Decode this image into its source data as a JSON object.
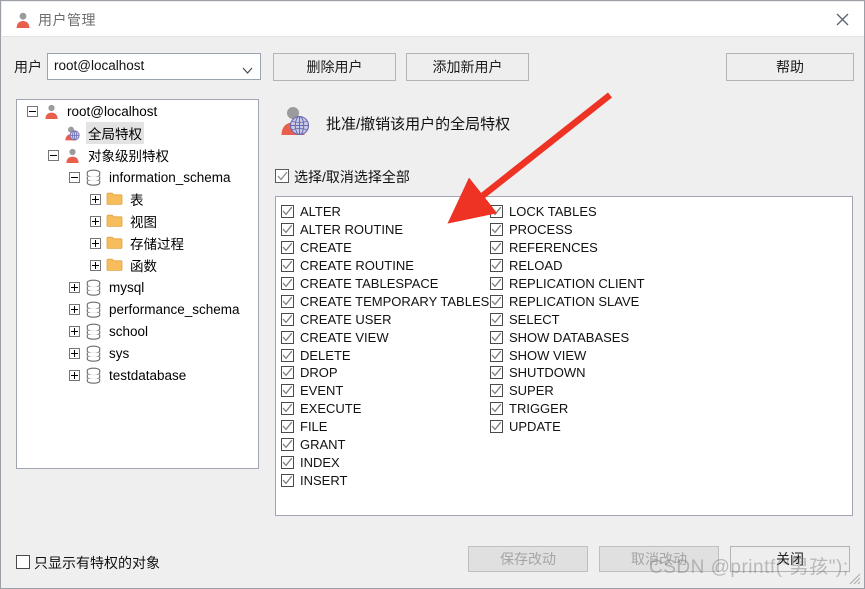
{
  "window": {
    "title": "用户管理",
    "title_icon": "user-icon",
    "close_icon": "close-icon"
  },
  "toolbar": {
    "user_label": "用户",
    "user_combo_value": "root@localhost",
    "user_combo_icon": "chevron-down-icon",
    "delete_user_label": "删除用户",
    "add_user_label": "添加新用户",
    "help_label": "帮助"
  },
  "tree": {
    "nodes": [
      {
        "label": "root@localhost",
        "indent": 0,
        "toggle": "minus",
        "icon": "user-icon",
        "selected": false
      },
      {
        "label": "全局特权",
        "indent": 1,
        "toggle": "none",
        "icon": "globe-user-icon",
        "selected": true
      },
      {
        "label": "对象级别特权",
        "indent": 1,
        "toggle": "minus",
        "icon": "user-icon",
        "selected": false
      },
      {
        "label": "information_schema",
        "indent": 2,
        "toggle": "minus",
        "icon": "database-icon",
        "selected": false
      },
      {
        "label": "表",
        "indent": 3,
        "toggle": "plus",
        "icon": "folder-icon",
        "selected": false
      },
      {
        "label": "视图",
        "indent": 3,
        "toggle": "plus",
        "icon": "folder-icon",
        "selected": false
      },
      {
        "label": "存储过程",
        "indent": 3,
        "toggle": "plus",
        "icon": "folder-icon",
        "selected": false
      },
      {
        "label": "函数",
        "indent": 3,
        "toggle": "plus",
        "icon": "folder-icon",
        "selected": false
      },
      {
        "label": "mysql",
        "indent": 2,
        "toggle": "plus",
        "icon": "database-icon",
        "selected": false
      },
      {
        "label": "performance_schema",
        "indent": 2,
        "toggle": "plus",
        "icon": "database-icon",
        "selected": false
      },
      {
        "label": "school",
        "indent": 2,
        "toggle": "plus",
        "icon": "database-icon",
        "selected": false
      },
      {
        "label": "sys",
        "indent": 2,
        "toggle": "plus",
        "icon": "database-icon",
        "selected": false
      },
      {
        "label": "testdatabase",
        "indent": 2,
        "toggle": "plus",
        "icon": "database-icon",
        "selected": false
      }
    ]
  },
  "privileges_header": {
    "icon": "globe-user-icon",
    "text": "批准/撤销该用户的全局特权"
  },
  "select_all": {
    "label": "选择/取消选择全部",
    "checked": true
  },
  "privileges": {
    "left_column": [
      {
        "label": "ALTER",
        "checked": true
      },
      {
        "label": "ALTER ROUTINE",
        "checked": true
      },
      {
        "label": "CREATE",
        "checked": true
      },
      {
        "label": "CREATE ROUTINE",
        "checked": true
      },
      {
        "label": "CREATE TABLESPACE",
        "checked": true
      },
      {
        "label": "CREATE TEMPORARY TABLES",
        "checked": true
      },
      {
        "label": "CREATE USER",
        "checked": true
      },
      {
        "label": "CREATE VIEW",
        "checked": true
      },
      {
        "label": "DELETE",
        "checked": true
      },
      {
        "label": "DROP",
        "checked": true
      },
      {
        "label": "EVENT",
        "checked": true
      },
      {
        "label": "EXECUTE",
        "checked": true
      },
      {
        "label": "FILE",
        "checked": true
      },
      {
        "label": "GRANT",
        "checked": true
      },
      {
        "label": "INDEX",
        "checked": true
      },
      {
        "label": "INSERT",
        "checked": true
      }
    ],
    "right_column": [
      {
        "label": "LOCK TABLES",
        "checked": true
      },
      {
        "label": "PROCESS",
        "checked": true
      },
      {
        "label": "REFERENCES",
        "checked": true
      },
      {
        "label": "RELOAD",
        "checked": true
      },
      {
        "label": "REPLICATION CLIENT",
        "checked": true
      },
      {
        "label": "REPLICATION SLAVE",
        "checked": true
      },
      {
        "label": "SELECT",
        "checked": true
      },
      {
        "label": "SHOW DATABASES",
        "checked": true
      },
      {
        "label": "SHOW VIEW",
        "checked": true
      },
      {
        "label": "SHUTDOWN",
        "checked": true
      },
      {
        "label": "SUPER",
        "checked": true
      },
      {
        "label": "TRIGGER",
        "checked": true
      },
      {
        "label": "UPDATE",
        "checked": true
      }
    ]
  },
  "footer": {
    "only_privileged_label": "只显示有特权的对象",
    "only_privileged_checked": false,
    "save_label": "保存改动",
    "save_disabled": true,
    "cancel_label": "取消改动",
    "cancel_disabled": true,
    "close_label": "关闭"
  },
  "annotation": {
    "arrow_color": "#ee3224",
    "arrow_name": "red-pointer-arrow"
  },
  "watermark": {
    "text": "CSDN @printf(\"男孩\");"
  },
  "colors": {
    "window_bg": "#efefef",
    "panel_bg": "#ffffff",
    "button_bg": "#e1e1e1",
    "border": "#a0a6b4",
    "folder": "#f5b942",
    "accent_red": "#ee3224"
  }
}
